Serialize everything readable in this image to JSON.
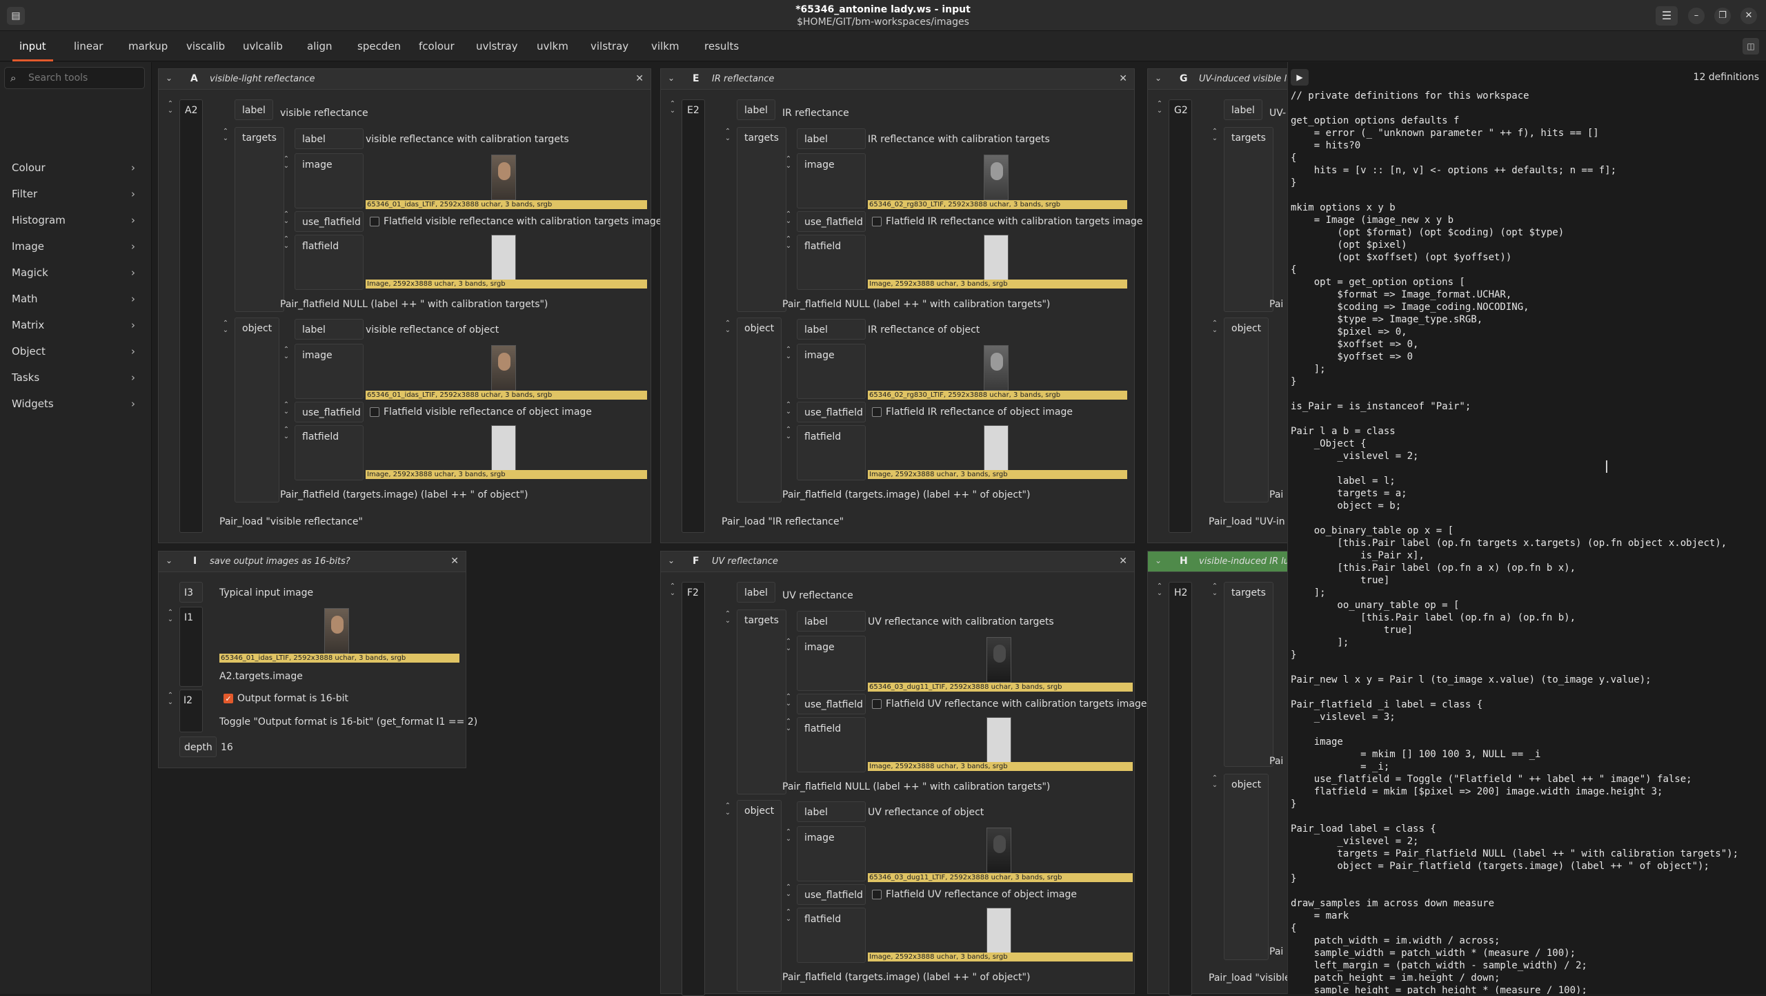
{
  "window": {
    "title": "*65346_antonine lady.ws - input",
    "subtitle": "$HOME/GIT/bm-workspaces/images",
    "app_icon": "workspace-icon",
    "menu_icon": "hamburger-menu-icon",
    "buttons": [
      "minimize",
      "maximize",
      "close"
    ]
  },
  "tabs": [
    "input",
    "linear",
    "markup",
    "viscalib",
    "uvlcalib",
    "align",
    "specden",
    "fcolour",
    "uvlstray",
    "uvlkm",
    "vilstray",
    "vilkm",
    "results"
  ],
  "active_tab": "input",
  "sidebar": {
    "search_placeholder": "Search tools",
    "items": [
      "Colour",
      "Filter",
      "Histogram",
      "Image",
      "Magick",
      "Math",
      "Matrix",
      "Object",
      "Tasks",
      "Widgets"
    ]
  },
  "columns": {
    "A": {
      "letter": "A",
      "title": "visible-light reflectance",
      "row_name": "A2",
      "label_key": "label",
      "label_value": "visible reflectance",
      "targets_key": "targets",
      "targets": {
        "label_value": "visible reflectance with calibration targets",
        "image_caption": "65346_01_idas_LTIF, 2592x3888 uchar, 3 bands, srgb",
        "use_flatfield_text": "Flatfield visible reflectance with calibration targets image",
        "flatfield_caption": "Image, 2592x3888 uchar, 3 bands, srgb",
        "formula": "Pair_flatfield NULL (label ++ \" with calibration targets\")"
      },
      "object_key": "object",
      "object": {
        "label_value": "visible reflectance of object",
        "image_caption": "65346_01_idas_LTIF, 2592x3888 uchar, 3 bands, srgb",
        "use_flatfield_text": "Flatfield visible reflectance of object image",
        "flatfield_caption": "Image, 2592x3888 uchar, 3 bands, srgb",
        "formula": "Pair_flatfield (targets.image) (label ++ \" of object\")"
      },
      "footer": "Pair_load \"visible reflectance\""
    },
    "E": {
      "letter": "E",
      "title": "IR reflectance",
      "row_name": "E2",
      "label_key": "label",
      "label_value": "IR reflectance",
      "targets_key": "targets",
      "targets": {
        "label_value": "IR reflectance with calibration targets",
        "image_caption": "65346_02_rg830_LTIF, 2592x3888 uchar, 3 bands, srgb",
        "use_flatfield_text": "Flatfield IR reflectance with calibration targets image",
        "flatfield_caption": "Image, 2592x3888 uchar, 3 bands, srgb",
        "formula": "Pair_flatfield NULL (label ++ \" with calibration targets\")"
      },
      "object_key": "object",
      "object": {
        "label_value": "IR reflectance of object",
        "image_caption": "65346_02_rg830_LTIF, 2592x3888 uchar, 3 bands, srgb",
        "use_flatfield_text": "Flatfield IR reflectance of object image",
        "flatfield_caption": "Image, 2592x3888 uchar, 3 bands, srgb",
        "formula": "Pair_flatfield (targets.image) (label ++ \" of object\")"
      },
      "footer": "Pair_load \"IR reflectance\""
    },
    "G": {
      "letter": "G",
      "title": "UV-induced visible lum",
      "row_name": "G2",
      "label_key": "label",
      "label_value": "UV-",
      "targets_key": "targets",
      "object_key": "object",
      "formula_a": "Pai",
      "formula_b": "Pai",
      "footer": "Pair_load \"UV-in"
    },
    "I": {
      "letter": "I",
      "title": "save output images as 16-bits?",
      "rows": {
        "i3_name": "I3",
        "i3_value": "Typical input image",
        "i1_name": "I1",
        "i1_caption": "65346_01_idas_LTIF, 2592x3888 uchar, 3 bands, srgb",
        "i1_formula": "A2.targets.image",
        "i2_name": "I2",
        "i2_text": "Output format is 16-bit",
        "i2_checked": true,
        "i2_formula": "Toggle \"Output format is 16-bit\" (get_format I1 == 2)",
        "depth_name": "depth",
        "depth_value": "16"
      }
    },
    "F": {
      "letter": "F",
      "title": "UV reflectance",
      "row_name": "F2",
      "label_key": "label",
      "label_value": "UV reflectance",
      "targets_key": "targets",
      "targets": {
        "label_value": "UV reflectance with calibration targets",
        "image_caption": "65346_03_dug11_LTIF, 2592x3888 uchar, 3 bands, srgb",
        "use_flatfield_text": "Flatfield UV reflectance with calibration targets image",
        "flatfield_caption": "Image, 2592x3888 uchar, 3 bands, srgb",
        "formula": "Pair_flatfield NULL (label ++ \" with calibration targets\")"
      },
      "object_key": "object",
      "object": {
        "label_value": "UV reflectance of object",
        "image_caption": "65346_03_dug11_LTIF, 2592x3888 uchar, 3 bands, srgb",
        "use_flatfield_text": "Flatfield UV reflectance of object image",
        "flatfield_caption": "Image, 2592x3888 uchar, 3 bands, srgb",
        "formula": "Pair_flatfield (targets.image) (label ++ \" of object\")"
      }
    },
    "H": {
      "letter": "H",
      "title": "visible-induced IR lum",
      "row_name": "H2",
      "targets_key": "targets",
      "object_key": "object",
      "formula_a": "Pai",
      "formula_b": "Pai",
      "footer": "Pair_load \"visible"
    }
  },
  "field_keys": {
    "label": "label",
    "image": "image",
    "use_flatfield": "use_flatfield",
    "flatfield": "flatfield"
  },
  "code_panel": {
    "definitions_count": "12 definitions",
    "code": "// private definitions for this workspace\n\nget_option options defaults f\n    = error (_ \"unknown parameter \" ++ f), hits == []\n    = hits?0\n{\n    hits = [v :: [n, v] <- options ++ defaults; n == f];\n}\n\nmkim options x y b\n    = Image (image_new x y b\n        (opt $format) (opt $coding) (opt $type)\n        (opt $pixel)\n        (opt $xoffset) (opt $yoffset))\n{\n    opt = get_option options [\n        $format => Image_format.UCHAR,\n        $coding => Image_coding.NOCODING,\n        $type => Image_type.sRGB,\n        $pixel => 0,\n        $xoffset => 0,\n        $yoffset => 0\n    ];\n}\n\nis_Pair = is_instanceof \"Pair\";\n\nPair l a b = class\n    _Object {\n        _vislevel = 2;\n\n        label = l;\n        targets = a;\n        object = b;\n\n    oo_binary_table op x = [\n        [this.Pair label (op.fn targets x.targets) (op.fn object x.object),\n            is_Pair x],\n        [this.Pair label (op.fn a x) (op.fn b x),\n            true]\n    ];\n        oo_unary_table op = [\n            [this.Pair label (op.fn a) (op.fn b),\n                true]\n        ];\n}\n\nPair_new l x y = Pair l (to_image x.value) (to_image y.value);\n\nPair_flatfield _i label = class {\n    _vislevel = 3;\n\n    image\n            = mkim [] 100 100 3, NULL == _i\n            = _i;\n    use_flatfield = Toggle (\"Flatfield \" ++ label ++ \" image\") false;\n    flatfield = mkim [$pixel => 200] image.width image.height 3;\n}\n\nPair_load label = class {\n        _vislevel = 2;\n        targets = Pair_flatfield NULL (label ++ \" with calibration targets\");\n        object = Pair_flatfield (targets.image) (label ++ \" of object\");\n}\n\ndraw_samples im across down measure\n    = mark\n{\n    patch_width = im.width / across;\n    sample_width = patch_width * (measure / 100);\n    left_margin = (patch_width - sample_width) / 2;\n    patch_height = im.height / down;\n    sample_height = patch_height * (measure / 100);"
  }
}
